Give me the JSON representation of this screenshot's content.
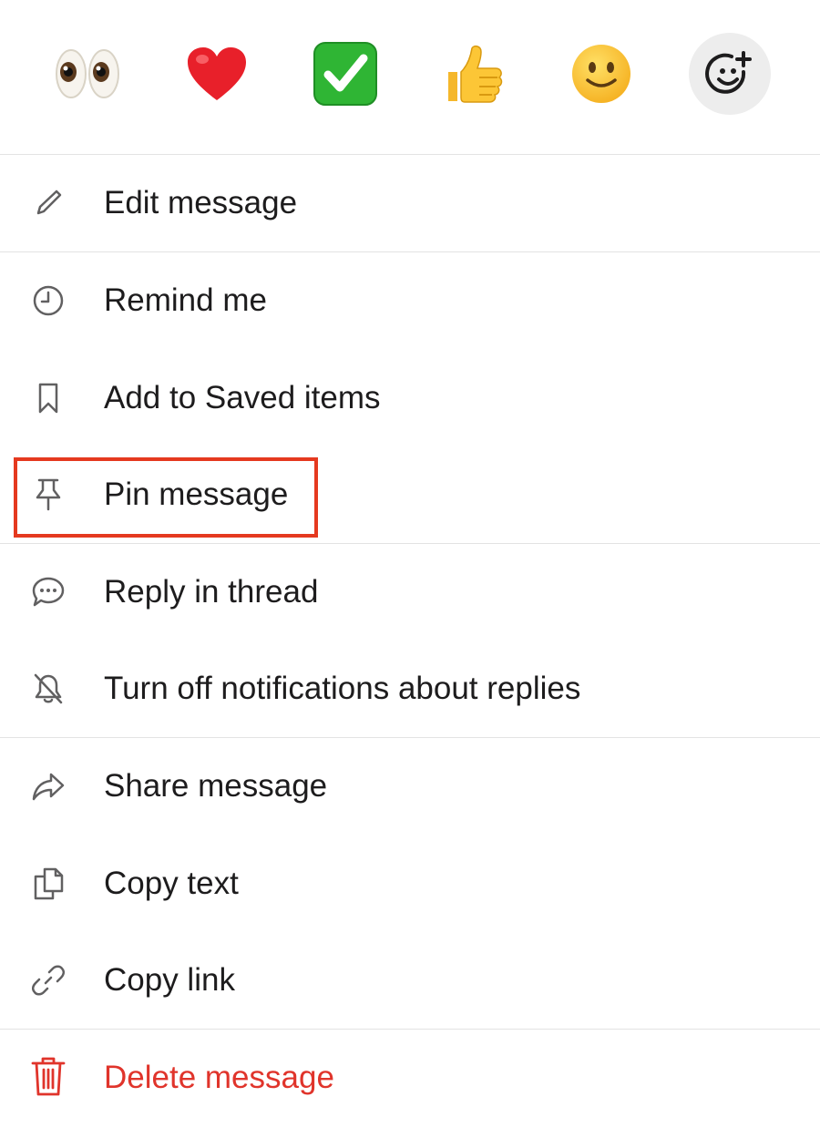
{
  "reactions": [
    {
      "name": "eyes",
      "emoji": "👀"
    },
    {
      "name": "heart",
      "emoji": "❤️"
    },
    {
      "name": "white-check-mark",
      "emoji": "✅"
    },
    {
      "name": "thumbsup",
      "emoji": "👍"
    },
    {
      "name": "slightly-smiling-face",
      "emoji": "🙂"
    },
    {
      "name": "add-reaction",
      "icon": "add-reaction-icon"
    }
  ],
  "menu": {
    "edit": {
      "label": "Edit message",
      "icon": "pencil-icon"
    },
    "remind": {
      "label": "Remind me",
      "icon": "clock-icon"
    },
    "save": {
      "label": "Add to Saved items",
      "icon": "bookmark-icon"
    },
    "pin": {
      "label": "Pin message",
      "icon": "pin-icon",
      "highlighted": true
    },
    "reply": {
      "label": "Reply in thread",
      "icon": "speech-bubble-icon"
    },
    "notifications": {
      "label": "Turn off notifications about replies",
      "icon": "bell-off-icon"
    },
    "share": {
      "label": "Share message",
      "icon": "share-arrow-icon"
    },
    "copy_text": {
      "label": "Copy text",
      "icon": "copy-icon"
    },
    "copy_link": {
      "label": "Copy link",
      "icon": "link-icon"
    },
    "delete": {
      "label": "Delete message",
      "icon": "trash-icon"
    }
  },
  "colors": {
    "text": "#1d1c1d",
    "icon": "#616061",
    "danger": "#e0342b",
    "highlight": "#e5391f",
    "divider": "#e3e3e3"
  }
}
